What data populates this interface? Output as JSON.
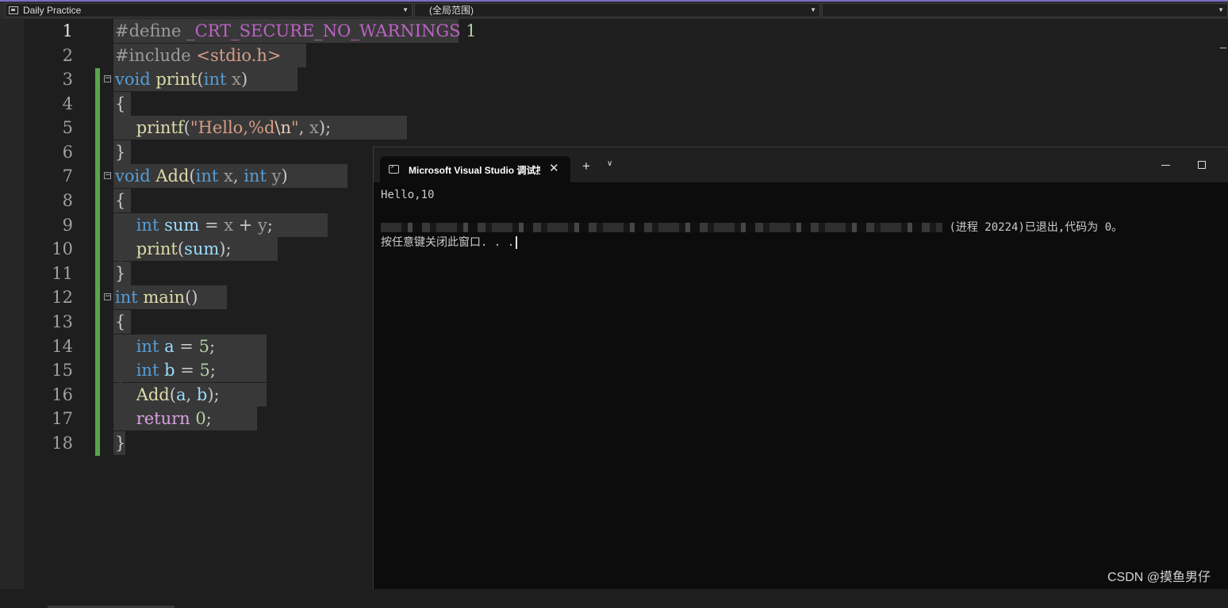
{
  "navbar": {
    "project": "Daily Practice",
    "scope": "(全局范围)",
    "member": ""
  },
  "editor": {
    "line_numbers": [
      "1",
      "2",
      "3",
      "4",
      "5",
      "6",
      "7",
      "8",
      "9",
      "10",
      "11",
      "12",
      "13",
      "14",
      "15",
      "16",
      "17",
      "18"
    ],
    "current_line": "1"
  },
  "terminal": {
    "tab_title": "Microsoft Visual Studio 调试控",
    "new_tab": "+",
    "tab_dropdown": "∨",
    "close_tab": "✕",
    "line1": "Hello,10",
    "line2_suffix": "(进程 20224)已退出,代码为 0。",
    "line3": "按任意键关闭此窗口. . ."
  },
  "watermark": "CSDN @摸鱼男仔",
  "colors": {
    "keyword": "#569cd6",
    "function": "#dcdcaa",
    "variable": "#9cdcfe",
    "string": "#d69d85",
    "number": "#b5cea8",
    "macro": "#bd63c5",
    "control": "#d8a0df",
    "change_bar": "#57a64a",
    "terminal_bg": "#0c0c0c"
  }
}
